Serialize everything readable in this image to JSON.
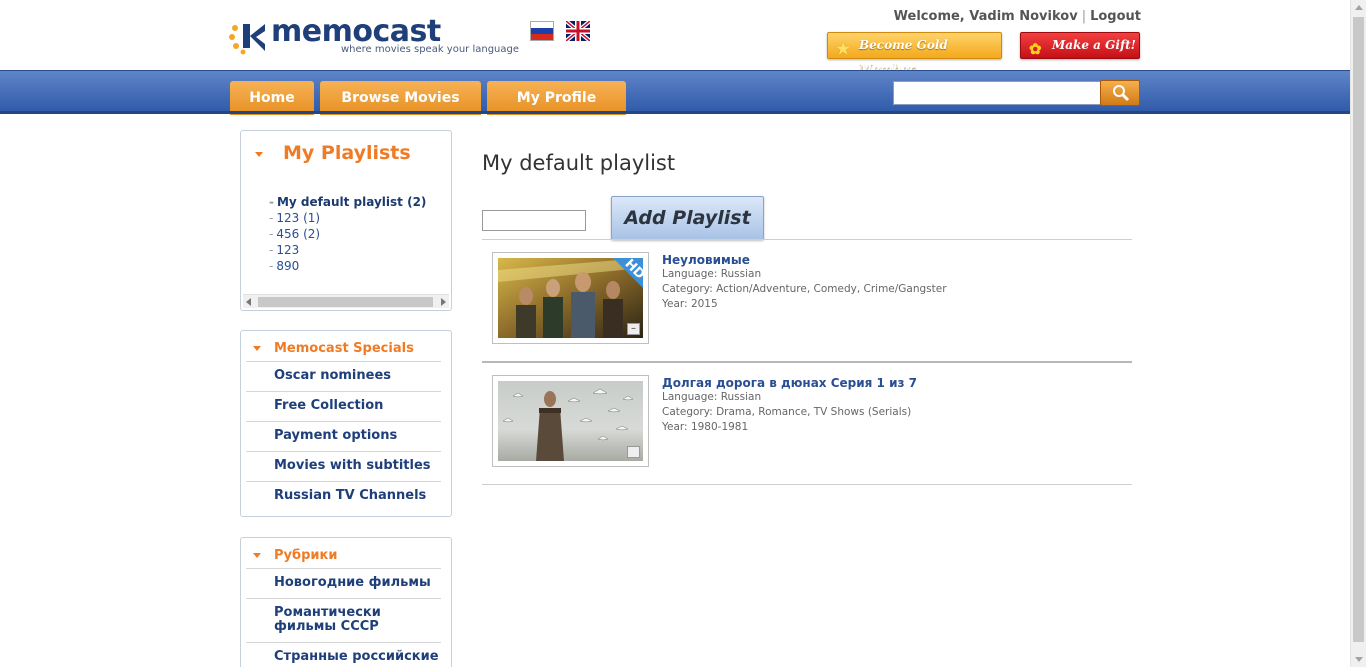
{
  "header": {
    "logo_text": "memocast",
    "logo_tagline": "where movies speak your language",
    "welcome_prefix": "Welcome,",
    "user_name": "Vadim Novikov",
    "logout_label": "Logout",
    "gold_button": "Become Gold Member",
    "gift_button": "Make a Gift!",
    "languages": [
      "ru-flag-icon",
      "uk-flag-icon"
    ]
  },
  "nav": {
    "tabs": [
      {
        "label": "Home"
      },
      {
        "label": "Browse Movies"
      },
      {
        "label": "My Profile"
      }
    ],
    "search_value": ""
  },
  "sidebar": {
    "playlists_title": "My Playlists",
    "playlists": [
      {
        "label": "My default playlist (2)"
      },
      {
        "label": "123 (1)"
      },
      {
        "label": "456 (2)"
      },
      {
        "label": "123"
      },
      {
        "label": "890"
      }
    ],
    "specials_title": "Memocast Specials",
    "specials": [
      {
        "label": "Oscar nominees"
      },
      {
        "label": "Free Collection"
      },
      {
        "label": "Payment options"
      },
      {
        "label": "Movies with subtitles"
      },
      {
        "label": "Russian TV Channels"
      }
    ],
    "rubrics_title": "Рубрики",
    "rubrics": [
      {
        "label": "Новогодние фильмы"
      },
      {
        "label": "Романтически фильмы СССР"
      },
      {
        "label": "Странные российские"
      }
    ]
  },
  "main": {
    "title": "My default playlist",
    "new_playlist_value": "",
    "add_playlist_label": "Add Playlist",
    "hd_badge": "HD",
    "movies": [
      {
        "title": "Неуловимые",
        "language_label": "Language:",
        "language": "Russian",
        "category_label": "Category:",
        "category": "Action/Adventure, Comedy, Crime/Gangster",
        "year_label": "Year:",
        "year": "2015"
      },
      {
        "title": "Долгая дорога в дюнах Серия 1 из 7",
        "language_label": "Language:",
        "language": "Russian",
        "category_label": "Category:",
        "category": "Drama, Romance, TV Shows (Serials)",
        "year_label": "Year:",
        "year": "1980-1981"
      }
    ]
  },
  "colors": {
    "accent_orange": "#f07b26",
    "nav_blue": "#2e58a8",
    "link_blue": "#2a4e92"
  }
}
